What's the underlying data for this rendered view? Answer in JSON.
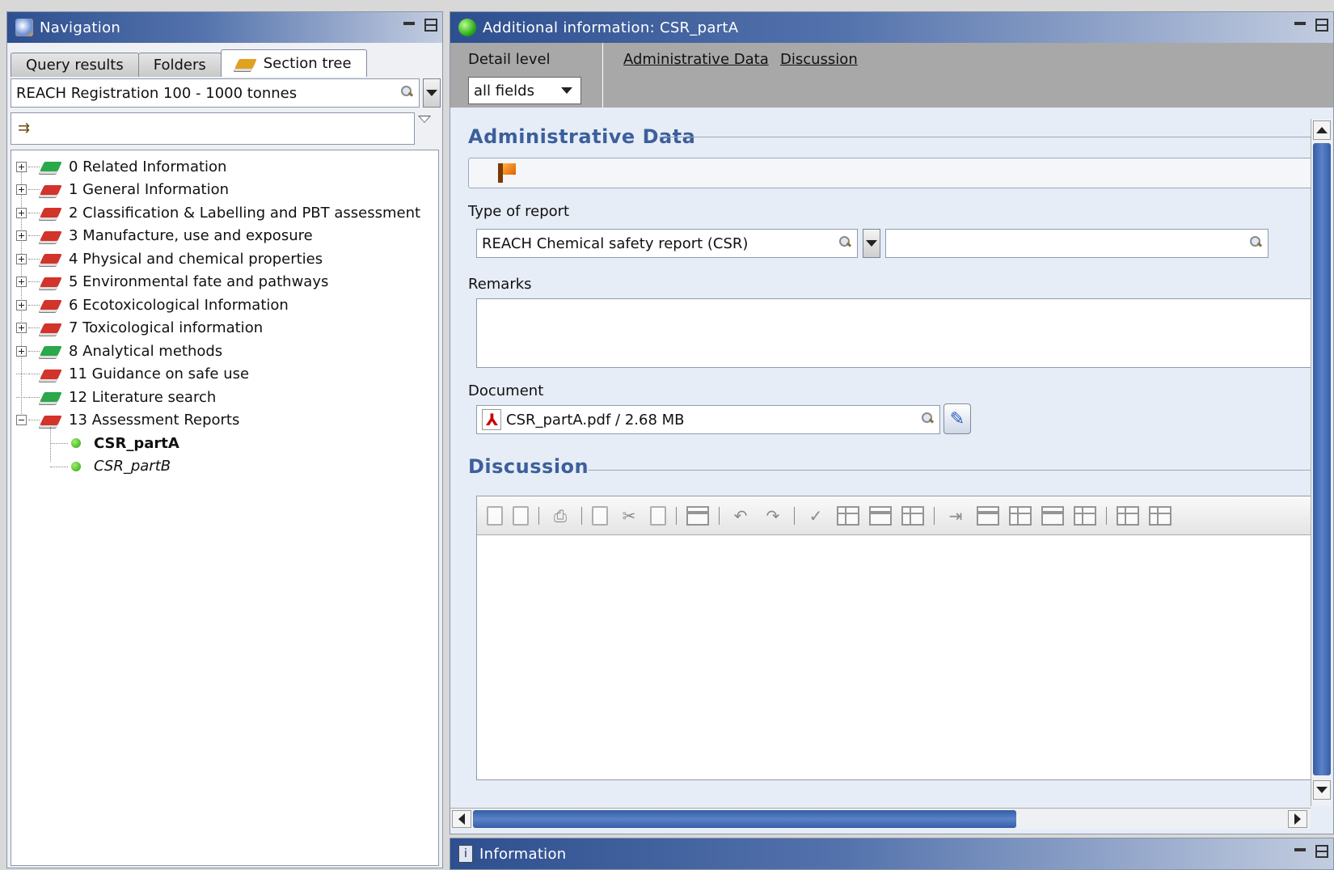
{
  "navigation": {
    "title": "Navigation",
    "tabs": [
      {
        "label": "Query results"
      },
      {
        "label": "Folders"
      },
      {
        "label": "Section tree"
      }
    ],
    "template_combo": "REACH Registration 100 - 1000 tonnes",
    "filter_value": "",
    "tree": [
      {
        "label": "0 Related Information",
        "book": "green",
        "expander": "plus"
      },
      {
        "label": "1 General Information",
        "book": "red",
        "expander": "plus"
      },
      {
        "label": "2 Classification & Labelling and PBT assessment",
        "book": "red",
        "expander": "plus"
      },
      {
        "label": "3 Manufacture, use and exposure",
        "book": "red",
        "expander": "plus"
      },
      {
        "label": "4 Physical and chemical properties",
        "book": "red",
        "expander": "plus"
      },
      {
        "label": "5 Environmental fate and pathways",
        "book": "red",
        "expander": "plus"
      },
      {
        "label": "6 Ecotoxicological Information",
        "book": "red",
        "expander": "plus"
      },
      {
        "label": "7 Toxicological information",
        "book": "red",
        "expander": "plus"
      },
      {
        "label": "8 Analytical methods",
        "book": "green",
        "expander": "plus"
      },
      {
        "label": "11 Guidance on safe use",
        "book": "red",
        "expander": "none"
      },
      {
        "label": "12 Literature search",
        "book": "green",
        "expander": "none"
      },
      {
        "label": "13 Assessment Reports",
        "book": "red",
        "expander": "minus"
      }
    ],
    "children": [
      {
        "label": "CSR_partA",
        "style": "bold"
      },
      {
        "label": "CSR_partB",
        "style": "italic"
      }
    ]
  },
  "detail": {
    "title": "Additional information: CSR_partA",
    "detail_level_label": "Detail level",
    "detail_level_value": "all fields",
    "links": [
      "Administrative Data",
      "Discussion"
    ],
    "admin_section_title": "Administrative Data",
    "type_of_report_label": "Type of report",
    "type_of_report_value": "REACH Chemical safety report (CSR)",
    "type_of_report_other": "",
    "remarks_label": "Remarks",
    "remarks_value": "",
    "document_label": "Document",
    "document_value": "CSR_partA.pdf / 2.68 MB",
    "discussion_section_title": "Discussion",
    "discussion_value": ""
  },
  "info_panel": {
    "title": "Information"
  },
  "colors": {
    "title_bar": "#2e4f8f",
    "section_title": "#3c5f9c",
    "status_green": "#2da01a",
    "book_green": "#2aa84a",
    "book_red": "#d2332a",
    "scroll_thumb": "#355da6"
  },
  "icons": {
    "navigation": "navigation-icon",
    "status": "green-status-icon",
    "flag": "flag-icon",
    "search": "search-icon",
    "attach": "paperclip-icon",
    "pdf": "pdf-icon",
    "info": "information-icon"
  }
}
